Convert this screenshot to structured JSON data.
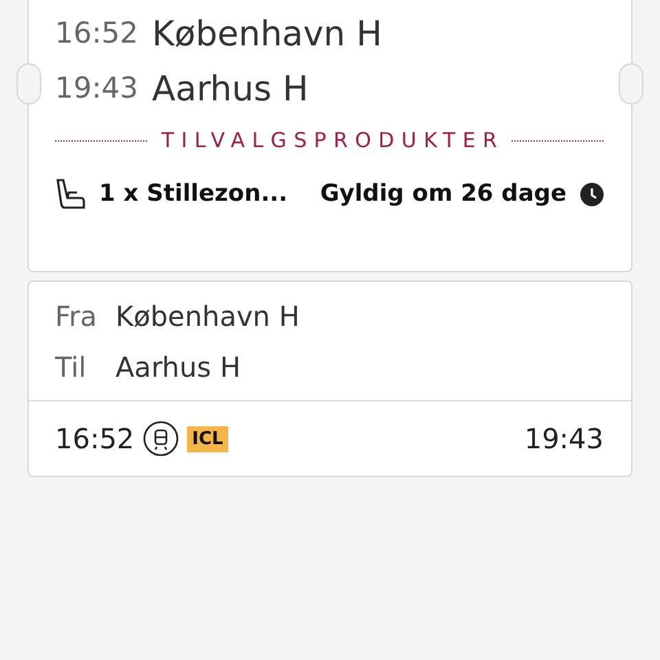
{
  "ticket": {
    "stops": [
      {
        "time": "16:52",
        "station": "København H"
      },
      {
        "time": "19:43",
        "station": "Aarhus H"
      }
    ],
    "section_title": "TILVALGSPRODUKTER",
    "product": {
      "name": "1 x Stillezon...",
      "validity": "Gyldig om 26 dage"
    }
  },
  "journey": {
    "from_label": "Fra",
    "from": "København H",
    "to_label": "Til",
    "to": "Aarhus H",
    "departure": "16:52",
    "train_type": "ICL",
    "arrival": "19:43"
  }
}
